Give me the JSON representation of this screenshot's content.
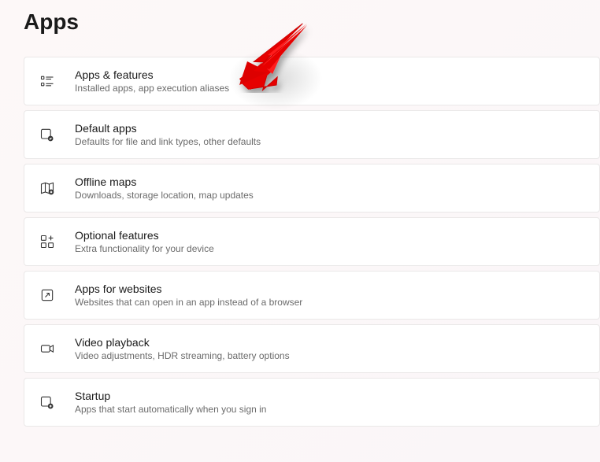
{
  "page": {
    "title": "Apps"
  },
  "items": [
    {
      "title": "Apps & features",
      "desc": "Installed apps, app execution aliases",
      "icon": "apps-features-icon"
    },
    {
      "title": "Default apps",
      "desc": "Defaults for file and link types, other defaults",
      "icon": "default-apps-icon"
    },
    {
      "title": "Offline maps",
      "desc": "Downloads, storage location, map updates",
      "icon": "offline-maps-icon"
    },
    {
      "title": "Optional features",
      "desc": "Extra functionality for your device",
      "icon": "optional-features-icon"
    },
    {
      "title": "Apps for websites",
      "desc": "Websites that can open in an app instead of a browser",
      "icon": "apps-websites-icon"
    },
    {
      "title": "Video playback",
      "desc": "Video adjustments, HDR streaming, battery options",
      "icon": "video-playback-icon"
    },
    {
      "title": "Startup",
      "desc": "Apps that start automatically when you sign in",
      "icon": "startup-icon"
    }
  ],
  "annotation": {
    "arrow_color": "#ff0000"
  }
}
